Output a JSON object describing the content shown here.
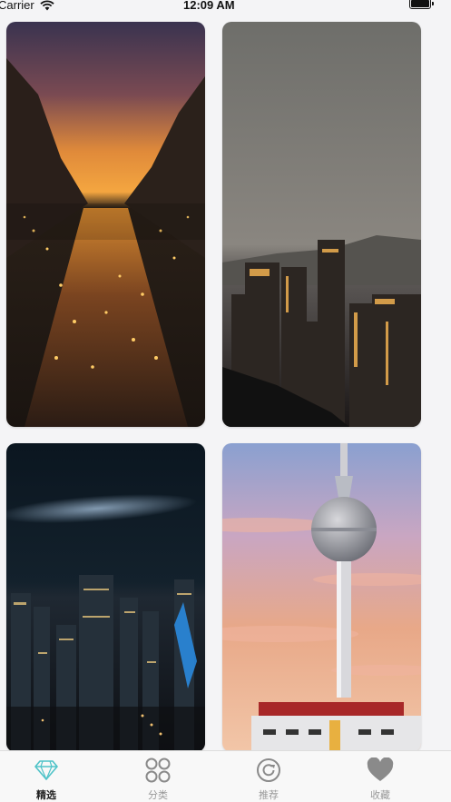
{
  "status_bar": {
    "carrier": "Carrier",
    "time": "12:09 AM"
  },
  "wallpapers": [
    {
      "name": "Canal at sunset"
    },
    {
      "name": "City skyline at dusk"
    },
    {
      "name": "City at night under the Milky Way"
    },
    {
      "name": "TV tower against pastel sky"
    }
  ],
  "tab_bar": {
    "active_index": 0,
    "tabs": [
      {
        "label": "精选",
        "icon": "diamond-icon"
      },
      {
        "label": "分类",
        "icon": "grid-icon"
      },
      {
        "label": "推荐",
        "icon": "refresh-icon"
      },
      {
        "label": "收藏",
        "icon": "heart-icon"
      }
    ]
  },
  "colors": {
    "accent": "#4fc3c8",
    "inactive": "#999999",
    "tab_bg": "#f8f8f8"
  }
}
